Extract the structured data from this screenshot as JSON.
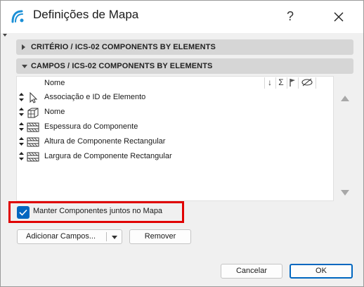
{
  "window": {
    "title": "Definições de Mapa",
    "help_label": "?"
  },
  "sections": [
    {
      "label": "CRITÉRIO / ICS-02 COMPONENTS BY ELEMENTS",
      "expanded": false
    },
    {
      "label": "CAMPOS / ICS-02 COMPONENTS BY ELEMENTS",
      "expanded": true
    }
  ],
  "list": {
    "header": {
      "name_label": "Nome",
      "col_sort_symbol": "↓",
      "col_sum_symbol": "Σ"
    },
    "rows": [
      {
        "label": "Associação e ID de Elemento",
        "icon": "pointer-arrow-icon"
      },
      {
        "label": "Nome",
        "icon": "building-element-icon"
      },
      {
        "label": "Espessura do Componente",
        "icon": "composite-hatch-icon"
      },
      {
        "label": "Altura de Componente Rectangular",
        "icon": "composite-hatch-icon"
      },
      {
        "label": "Largura de Componente Rectangular",
        "icon": "composite-hatch-icon"
      }
    ]
  },
  "keep_together": {
    "label": "Manter Componentes juntos no Mapa",
    "checked": true
  },
  "buttons": {
    "add_fields": "Adicionar Campos...",
    "remove": "Remover",
    "cancel": "Cancelar",
    "ok": "OK"
  },
  "colors": {
    "accent": "#0067c0",
    "highlight_border": "#e00000",
    "section_bg": "#d6d6d6"
  }
}
